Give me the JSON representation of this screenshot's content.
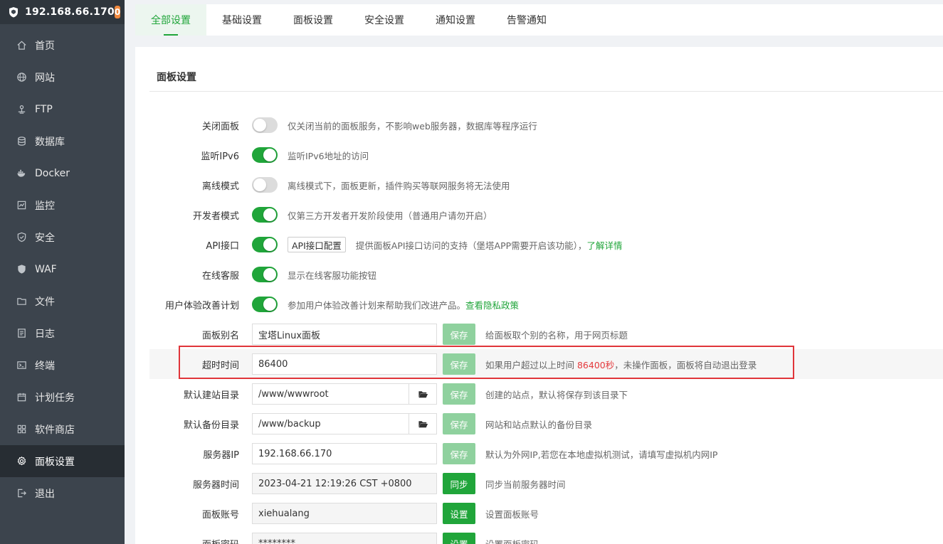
{
  "header": {
    "ip": "192.168.66.170",
    "badge": "0"
  },
  "sidebar": {
    "items": [
      {
        "label": "首页",
        "icon": "home-icon"
      },
      {
        "label": "网站",
        "icon": "globe-icon"
      },
      {
        "label": "FTP",
        "icon": "ftp-icon"
      },
      {
        "label": "数据库",
        "icon": "database-icon"
      },
      {
        "label": "Docker",
        "icon": "docker-icon"
      },
      {
        "label": "监控",
        "icon": "monitor-icon"
      },
      {
        "label": "安全",
        "icon": "shield-icon"
      },
      {
        "label": "WAF",
        "icon": "waf-shield-icon"
      },
      {
        "label": "文件",
        "icon": "folder-icon"
      },
      {
        "label": "日志",
        "icon": "log-icon"
      },
      {
        "label": "终端",
        "icon": "terminal-icon"
      },
      {
        "label": "计划任务",
        "icon": "calendar-icon"
      },
      {
        "label": "软件商店",
        "icon": "apps-icon"
      },
      {
        "label": "面板设置",
        "icon": "gear-icon"
      },
      {
        "label": "退出",
        "icon": "logout-icon"
      }
    ],
    "active_index": 13
  },
  "tabs": [
    "全部设置",
    "基础设置",
    "面板设置",
    "安全设置",
    "通知设置",
    "告警通知"
  ],
  "panel": {
    "title": "面板设置",
    "rows": {
      "close_panel": {
        "label": "关闭面板",
        "on": false,
        "desc": "仅关闭当前的面板服务，不影响web服务器，数据库等程序运行"
      },
      "ipv6": {
        "label": "监听IPv6",
        "on": true,
        "desc": "监听IPv6地址的访问"
      },
      "offline": {
        "label": "离线模式",
        "on": false,
        "desc": "离线模式下，面板更新，插件购买等联网服务将无法使用"
      },
      "developer": {
        "label": "开发者模式",
        "on": true,
        "desc": "仅第三方开发者开发阶段使用（普通用户请勿开启）"
      },
      "api": {
        "label": "API接口",
        "on": true,
        "button": "API接口配置",
        "desc": "提供面板API接口访问的支持（堡塔APP需要开启该功能），",
        "link": "了解详情"
      },
      "online_service": {
        "label": "在线客服",
        "on": true,
        "desc": "显示在线客服功能按钮"
      },
      "ux_plan": {
        "label": "用户体验改善计划",
        "on": true,
        "desc": "参加用户体验改善计划来帮助我们改进产品。",
        "link": "查看隐私政策"
      },
      "alias": {
        "label": "面板别名",
        "value": "宝塔Linux面板",
        "button": "保存",
        "desc": "给面板取个别的名称，用于网页标题"
      },
      "timeout": {
        "label": "超时时间",
        "value": "86400",
        "button": "保存",
        "desc_pre": "如果用户超过以上时间 ",
        "desc_highlight": "86400秒",
        "desc_post": "，未操作面板，面板将自动退出登录"
      },
      "site_dir": {
        "label": "默认建站目录",
        "value": "/www/wwwroot",
        "button": "保存",
        "desc": "创建的站点，默认将保存到该目录下"
      },
      "backup_dir": {
        "label": "默认备份目录",
        "value": "/www/backup",
        "button": "保存",
        "desc": "网站和站点默认的备份目录"
      },
      "server_ip": {
        "label": "服务器IP",
        "value": "192.168.66.170",
        "button": "保存",
        "desc": "默认为外网IP,若您在本地虚拟机测试，请填写虚拟机内网IP"
      },
      "server_time": {
        "label": "服务器时间",
        "value": "2023-04-21 12:19:26 CST +0800",
        "button": "同步",
        "desc": "同步当前服务器时间"
      },
      "account": {
        "label": "面板账号",
        "value": "xiehualang",
        "button": "设置",
        "desc": "设置面板账号"
      },
      "password": {
        "label": "面板密码",
        "value": "********",
        "button": "设置",
        "desc": "设置面板密码"
      }
    }
  },
  "colors": {
    "accent": "#20a53a",
    "sidebar": "#3c444d",
    "highlight_box": "#e0353a",
    "badge": "#f0883c"
  }
}
